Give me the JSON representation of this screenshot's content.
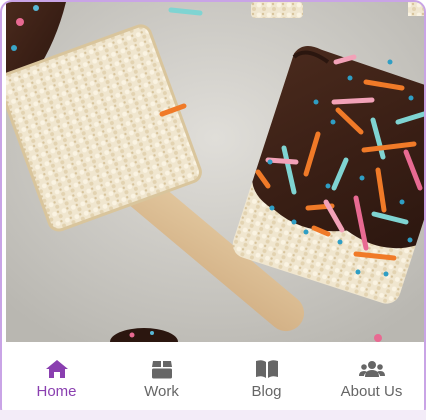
{
  "hero_image": {
    "alt": "chocolate dipped rice krispie pops with colorful sprinkles"
  },
  "nav": {
    "accent_color": "#8a3fb0",
    "items": [
      {
        "label": "Home",
        "icon": "home-icon",
        "active": true
      },
      {
        "label": "Work",
        "icon": "box-icon",
        "active": false
      },
      {
        "label": "Blog",
        "icon": "book-icon",
        "active": false
      },
      {
        "label": "About Us",
        "icon": "users-icon",
        "active": false
      }
    ]
  }
}
